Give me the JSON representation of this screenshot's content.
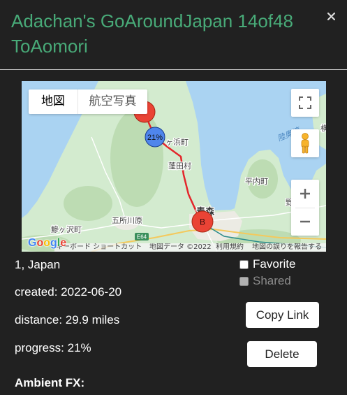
{
  "modal": {
    "title": "Adachan's GoAroundJapan 14of48 ToAomori"
  },
  "map": {
    "type_control": {
      "map": "地図",
      "satellite": "航空写真"
    },
    "labels": {
      "sotogahama": "ヶ浜町",
      "yomogita": "蓬田村",
      "hiranai": "平内町",
      "goshogawara": "五所川原",
      "ajigasawa": "鰺ヶ沢町",
      "aomori": "青森",
      "mutsu_bay": "陸奥湾",
      "yokohama_partial": "横",
      "no_partial": "野"
    },
    "highway_shield": "E64",
    "markers": {
      "progress": "21%",
      "destination": "B"
    },
    "google_logo": "Google",
    "logo_colors": [
      "#4285f4",
      "#ea4335",
      "#fbbc05",
      "#4285f4",
      "#34a853",
      "#ea4335"
    ],
    "attribution": {
      "keyboard_shortcuts": "キーボード ショートカット",
      "map_data": "地図データ ©2022",
      "terms": "利用規約",
      "report_error": "地図の誤りを報告する"
    }
  },
  "details": {
    "location": "1, Japan",
    "created": {
      "label": "created:",
      "value": "2022-06-20"
    },
    "distance": {
      "label": "distance:",
      "value": "29.9 miles"
    },
    "progress": {
      "label": "progress:",
      "value": "21%"
    },
    "ambient_fx": "Ambient FX:"
  },
  "options": {
    "favorite": {
      "label": "Favorite",
      "checked": false
    },
    "shared": {
      "label": "Shared",
      "checked": false,
      "disabled": true
    }
  },
  "actions": {
    "copy_link": "Copy Link",
    "delete": "Delete"
  },
  "icons": {
    "close": "close-icon",
    "fullscreen": "fullscreen-icon",
    "street_view": "pegman-icon",
    "zoom_in": "plus-icon",
    "zoom_out": "minus-icon"
  },
  "colors": {
    "background": "#212121",
    "title": "#48aa78",
    "text": "#ffffff",
    "muted": "#8c8c8c",
    "route": "#e3262b",
    "marker_red": "#ea4335",
    "marker_blue": "#4f86ec",
    "water": "#aad3f2",
    "land": "#d3ebcf"
  }
}
